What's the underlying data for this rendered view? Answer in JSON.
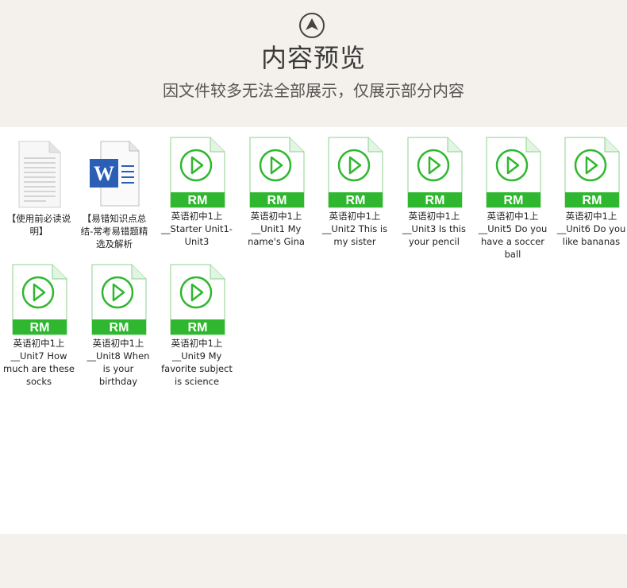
{
  "header": {
    "title": "内容预览",
    "subtitle": "因文件较多无法全部展示，仅展示部分内容"
  },
  "colors": {
    "page_bg": "#f4f1ec",
    "content_bg": "#ffffff",
    "rm_green": "#2fb82f",
    "word_blue": "#2b5eb5"
  },
  "files": [
    {
      "icon": "text-document-icon",
      "label": "【使用前必读说明】"
    },
    {
      "icon": "word-document-icon",
      "label": "【易错知识点总结-常考易错题精选及解析"
    },
    {
      "icon": "rm-media-file-icon",
      "badge": "RM",
      "label": "英语初中1上__Starter Unit1-Unit3"
    },
    {
      "icon": "rm-media-file-icon",
      "badge": "RM",
      "label": "英语初中1上__Unit1 My name's Gina"
    },
    {
      "icon": "rm-media-file-icon",
      "badge": "RM",
      "label": "英语初中1上__Unit2 This is my sister"
    },
    {
      "icon": "rm-media-file-icon",
      "badge": "RM",
      "label": "英语初中1上__Unit3 Is this your pencil"
    },
    {
      "icon": "rm-media-file-icon",
      "badge": "RM",
      "label": "英语初中1上__Unit5 Do you have a soccer ball"
    },
    {
      "icon": "rm-media-file-icon",
      "badge": "RM",
      "label": "英语初中1上__Unit6 Do you like bananas"
    },
    {
      "icon": "rm-media-file-icon",
      "badge": "RM",
      "label": "英语初中1上__Unit7 How much are these socks"
    },
    {
      "icon": "rm-media-file-icon",
      "badge": "RM",
      "label": "英语初中1上__Unit8 When is your birthday"
    },
    {
      "icon": "rm-media-file-icon",
      "badge": "RM",
      "label": "英语初中1上__Unit9 My favorite subject is science"
    }
  ]
}
